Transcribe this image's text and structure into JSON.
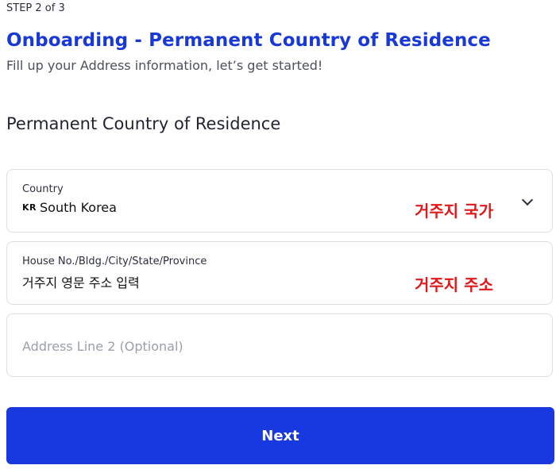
{
  "header": {
    "step": "STEP 2 of 3",
    "title": "Onboarding - Permanent Country of Residence",
    "subtitle": "Fill up your Address information, let’s get started!"
  },
  "section": {
    "heading": "Permanent Country of Residence"
  },
  "fields": {
    "country": {
      "label": "Country",
      "code": "KR",
      "value": "South Korea",
      "annotation": "거주지 국가",
      "icon": "chevron-down-icon"
    },
    "address1": {
      "label": "House No./Bldg./City/State/Province",
      "value": "거주지 영문 주소 입력",
      "annotation": "거주지 주소"
    },
    "address2": {
      "placeholder": "Address Line 2 (Optional)",
      "value": ""
    }
  },
  "actions": {
    "next_label": "Next"
  },
  "colors": {
    "accent": "#1838e0",
    "annotation": "#e0181a"
  }
}
